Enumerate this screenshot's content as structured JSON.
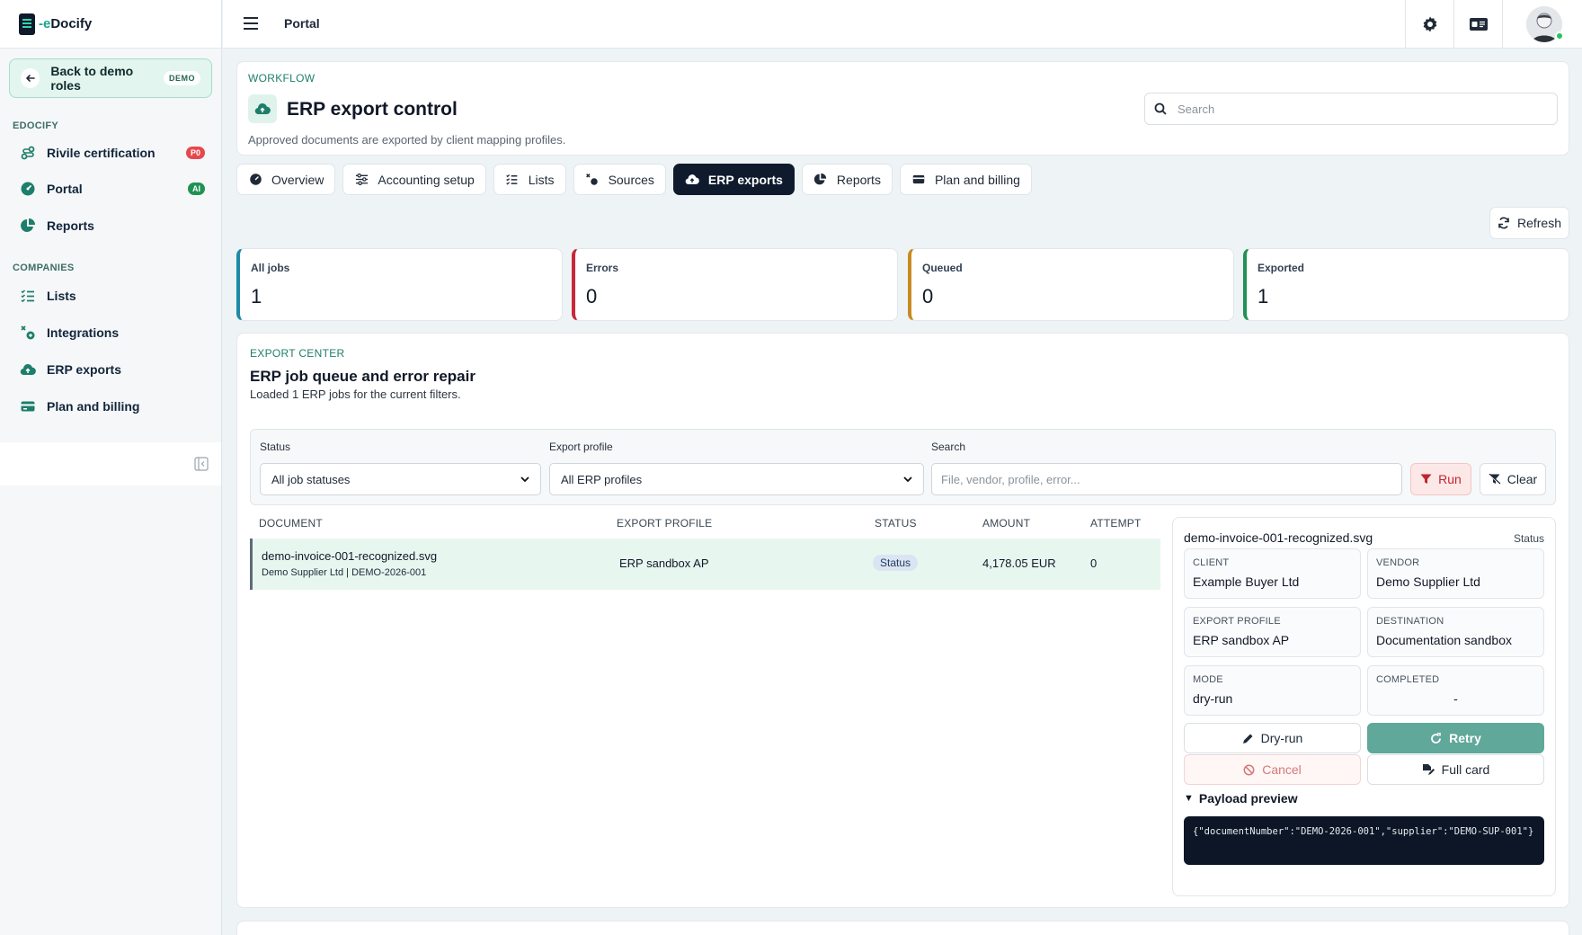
{
  "app": {
    "brand_prefix": "-e",
    "brand_name": "Docify"
  },
  "sidebar": {
    "back": {
      "label": "Back to demo roles",
      "tag": "DEMO"
    },
    "group1": "EDOCIFY",
    "group2": "COMPANIES",
    "items": [
      {
        "label": "Rivile certification",
        "badge": "P0",
        "badge_color": "#e5484d",
        "icon": "route-icon"
      },
      {
        "label": "Portal",
        "badge": "AI",
        "badge_color": "#1f9254",
        "icon": "gauge-icon"
      },
      {
        "label": "Reports",
        "icon": "pie-chart-icon"
      },
      {
        "label": "Lists",
        "icon": "list-icon"
      },
      {
        "label": "Integrations",
        "icon": "integrations-icon"
      },
      {
        "label": "ERP exports",
        "icon": "cloud-upload-icon"
      },
      {
        "label": "Plan and billing",
        "icon": "credit-card-icon"
      }
    ]
  },
  "topbar": {
    "title": "Portal"
  },
  "header": {
    "eyebrow": "WORKFLOW",
    "title": "ERP export control",
    "subtitle": "Approved documents are exported by client mapping profiles.",
    "search_placeholder": "Search"
  },
  "tabs": [
    {
      "label": "Overview",
      "icon": "gauge-icon"
    },
    {
      "label": "Accounting setup",
      "icon": "sliders-icon"
    },
    {
      "label": "Lists",
      "icon": "list-icon"
    },
    {
      "label": "Sources",
      "icon": "sources-icon"
    },
    {
      "label": "ERP exports",
      "icon": "cloud-upload-icon",
      "active": true
    },
    {
      "label": "Reports",
      "icon": "pie-chart-icon"
    },
    {
      "label": "Plan and billing",
      "icon": "credit-card-icon"
    }
  ],
  "refresh_label": "Refresh",
  "stats": [
    {
      "label": "All jobs",
      "value": "1",
      "color": "#1f8aa8"
    },
    {
      "label": "Errors",
      "value": "0",
      "color": "#c8283a"
    },
    {
      "label": "Queued",
      "value": "0",
      "color": "#c98a22"
    },
    {
      "label": "Exported",
      "value": "1",
      "color": "#1f9254"
    }
  ],
  "export_center": {
    "eyebrow": "EXPORT CENTER",
    "title": "ERP job queue and error repair",
    "subtitle": "Loaded 1 ERP jobs for the current filters.",
    "filters": {
      "status_label": "Status",
      "status_value": "All job statuses",
      "profile_label": "Export profile",
      "profile_value": "All ERP profiles",
      "search_label": "Search",
      "search_placeholder": "File, vendor, profile, error...",
      "run_label": "Run",
      "clear_label": "Clear"
    },
    "columns": [
      "DOCUMENT",
      "EXPORT PROFILE",
      "STATUS",
      "AMOUNT",
      "ATTEMPT"
    ],
    "rows": [
      {
        "document": "demo-invoice-001-recognized.svg",
        "meta": "Demo Supplier Ltd | DEMO-2026-001",
        "profile": "ERP sandbox AP",
        "status": "Status",
        "amount": "4,178.05 EUR",
        "attempt": "0"
      }
    ],
    "detail": {
      "title": "demo-invoice-001-recognized.svg",
      "status": "Status",
      "fields": [
        {
          "label": "CLIENT",
          "value": "Example Buyer Ltd"
        },
        {
          "label": "VENDOR",
          "value": "Demo Supplier Ltd"
        },
        {
          "label": "EXPORT PROFILE",
          "value": "ERP sandbox AP"
        },
        {
          "label": "DESTINATION",
          "value": "Documentation sandbox"
        },
        {
          "label": "MODE",
          "value": "dry-run"
        },
        {
          "label": "COMPLETED",
          "value": "-"
        }
      ],
      "actions": {
        "dry_run": "Dry-run",
        "retry": "Retry",
        "cancel": "Cancel",
        "full_card": "Full card"
      },
      "payload_label": "Payload preview",
      "payload": "{\"documentNumber\":\"DEMO-2026-001\",\"supplier\":\"DEMO-SUP-001\"}"
    }
  }
}
